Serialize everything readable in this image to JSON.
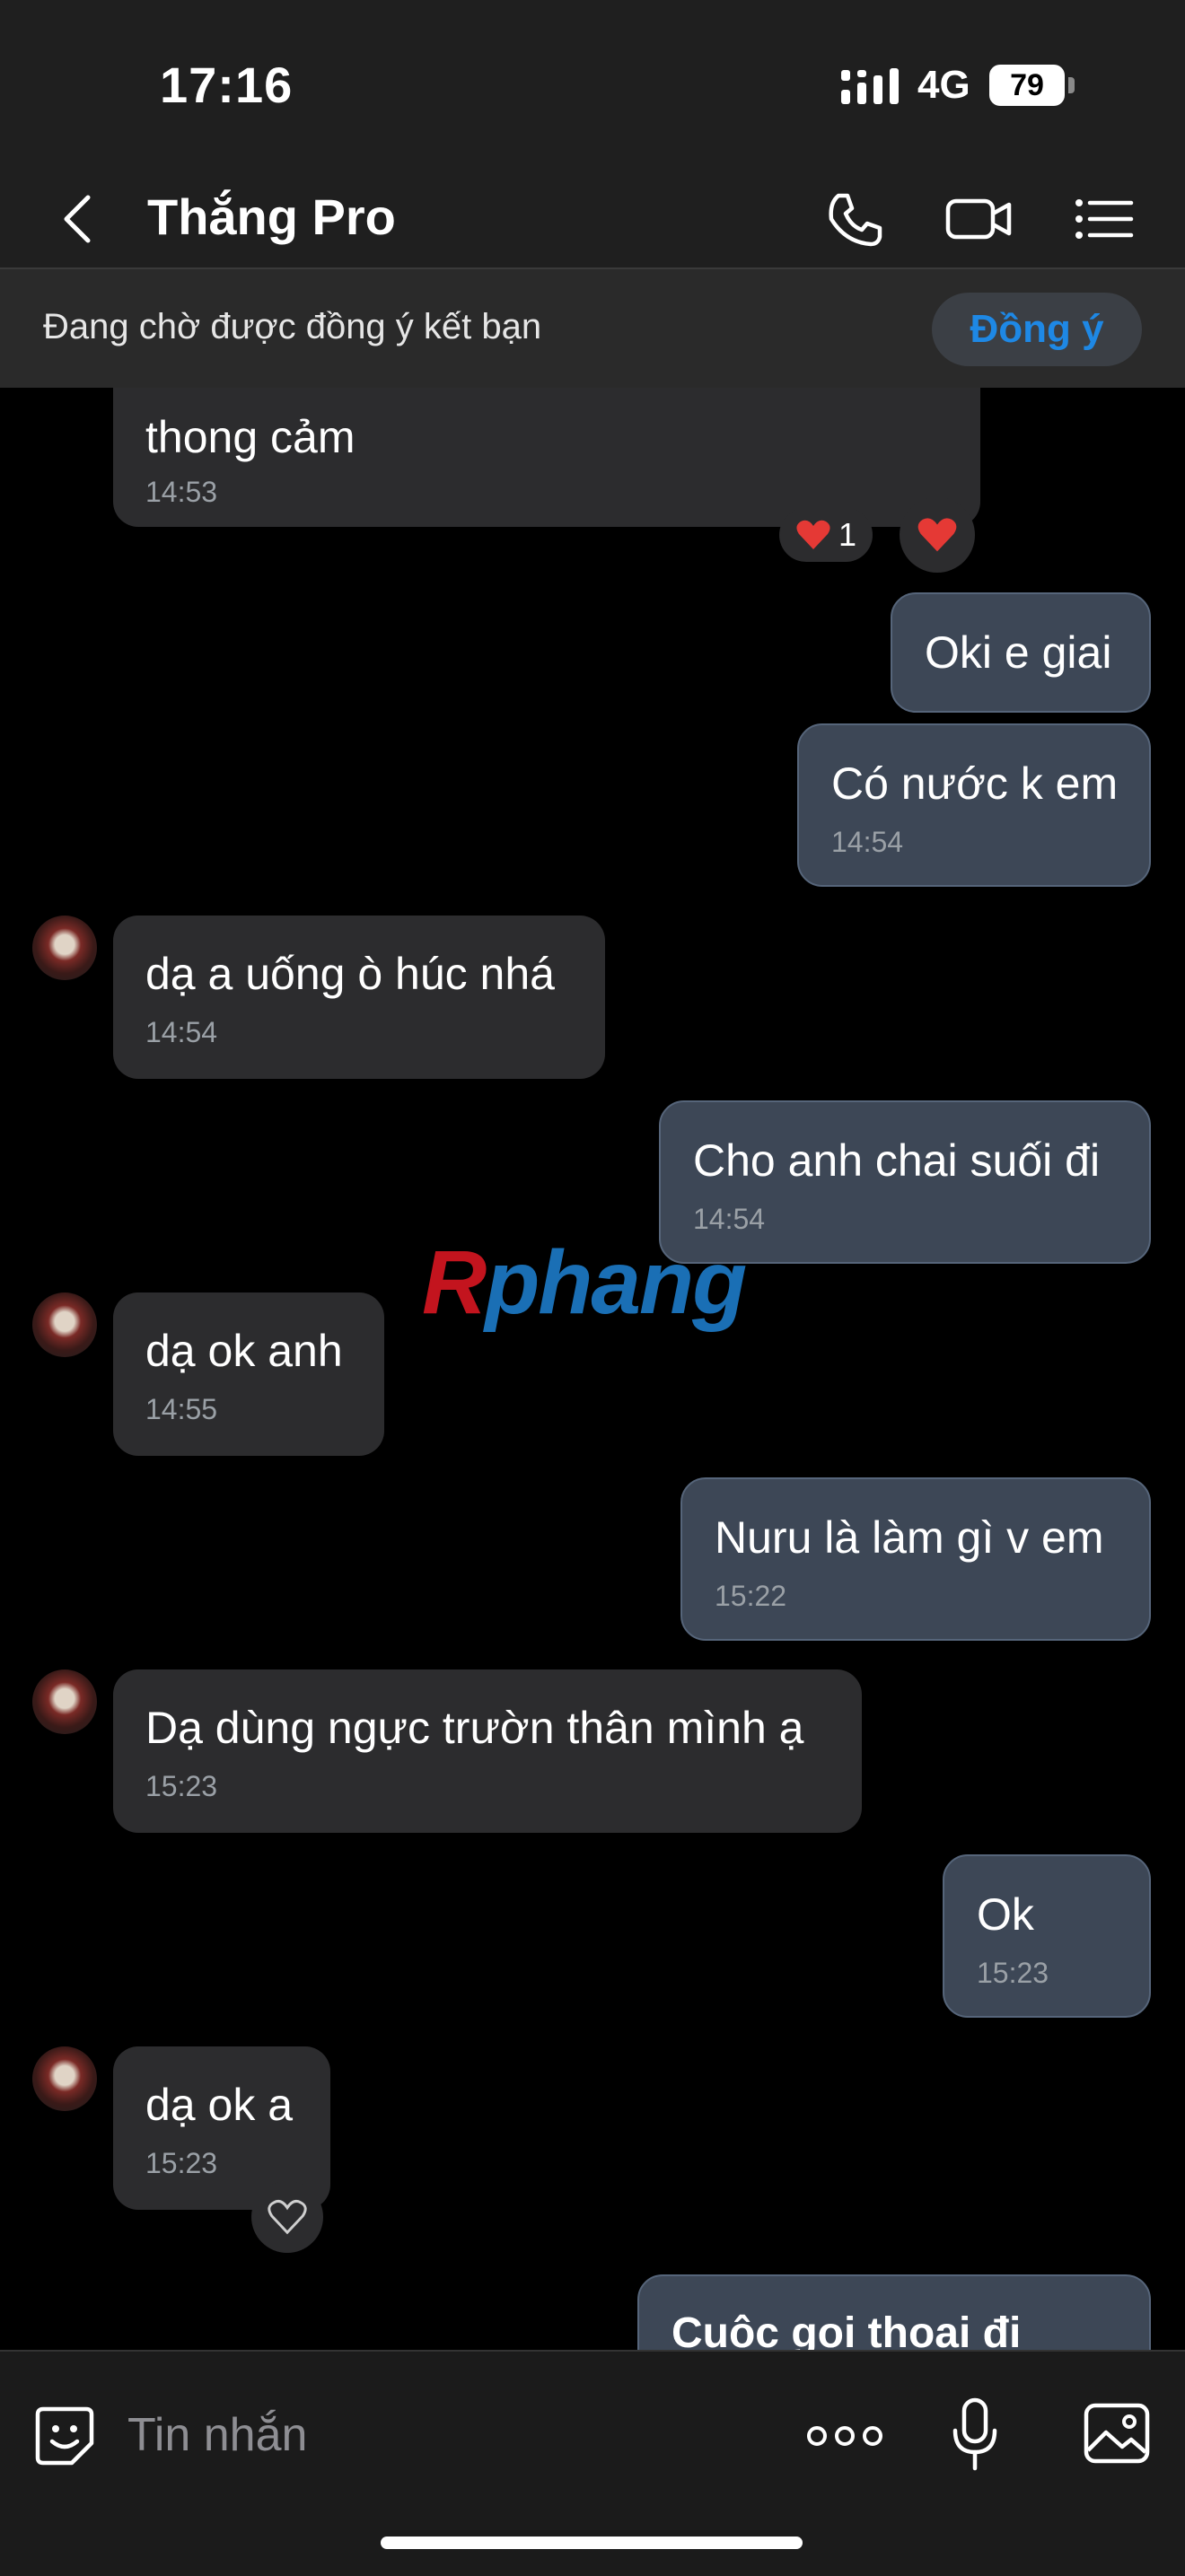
{
  "status_bar": {
    "time": "17:16",
    "network": "4G",
    "battery": "79"
  },
  "header": {
    "title": "Thắng Pro",
    "icons": [
      "chevron-left-icon",
      "phone-icon",
      "video-camera-icon",
      "list-menu-icon"
    ]
  },
  "banner": {
    "text": "Đang chờ được đồng ý kết bạn",
    "accept_label": "Đồng ý"
  },
  "chat": {
    "first_message": {
      "text": "thong cảm",
      "time": "14:53"
    },
    "reactions": {
      "count": "1"
    },
    "messages": [
      {
        "dir": "out",
        "text": "Oki e giai",
        "time": ""
      },
      {
        "dir": "out",
        "text": "Có nước k em",
        "time": "14:54"
      },
      {
        "dir": "in",
        "text": "dạ a uống ò húc nhá",
        "time": "14:54"
      },
      {
        "dir": "out",
        "text": "Cho anh chai suối đi",
        "time": "14:54"
      },
      {
        "dir": "in",
        "text": "dạ ok anh",
        "time": "14:55"
      },
      {
        "dir": "out",
        "text": "Nuru là làm gì v em",
        "time": "15:22"
      },
      {
        "dir": "in",
        "text": "Dạ dùng ngực trườn thân mình ạ",
        "time": "15:23"
      },
      {
        "dir": "out",
        "text": "Ok",
        "time": "15:23"
      },
      {
        "dir": "in",
        "text": "dạ ok a",
        "time": "15:23"
      },
      {
        "dir": "out",
        "text": "Cuộc gọi thoại đi",
        "time": ""
      }
    ],
    "watermark": {
      "r": "R",
      "rest": "phang"
    }
  },
  "input_bar": {
    "placeholder": "Tin nhắn"
  },
  "colors": {
    "accent": "#1e88e5",
    "incoming_bubble": "#2c2c2e",
    "outgoing_bubble": "#3d4756",
    "background": "#000000"
  }
}
